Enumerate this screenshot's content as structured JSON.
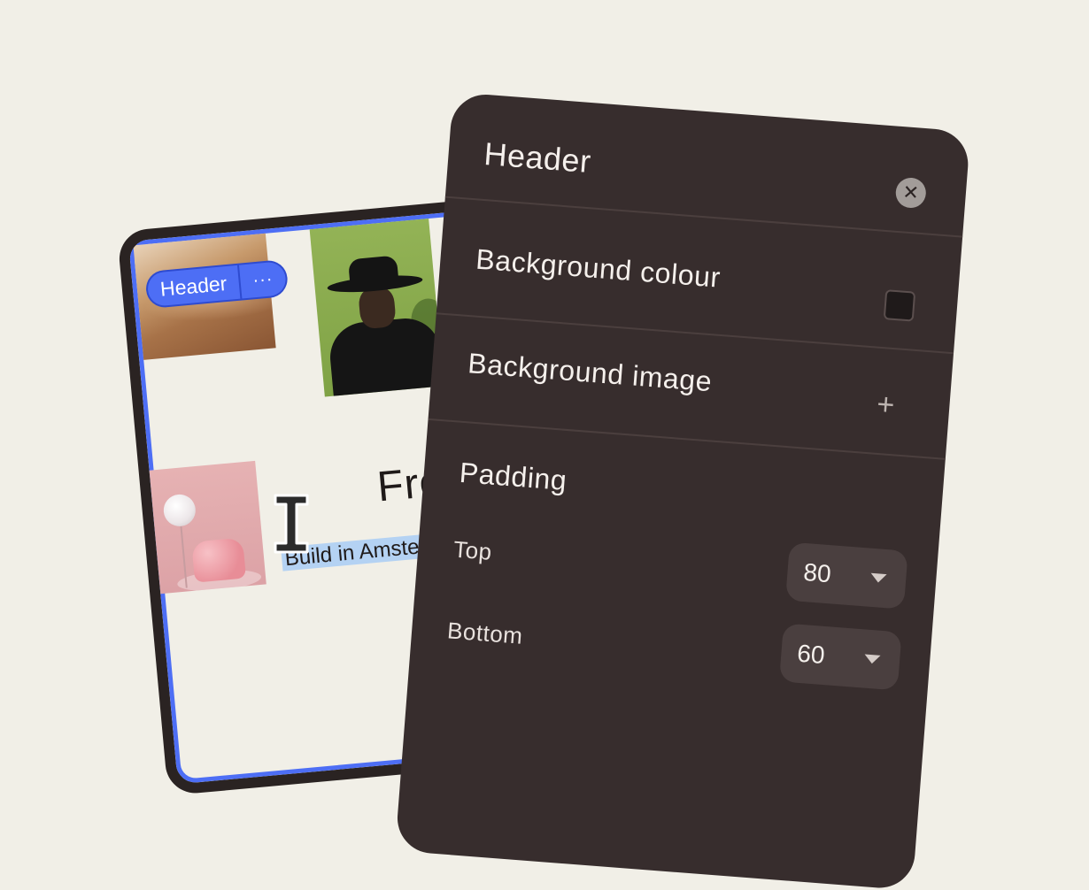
{
  "canvas": {
    "chip": {
      "label": "Header",
      "more": "···"
    },
    "hero": {
      "title": "From",
      "subtitle": "Build in Amsterd who are ge"
    },
    "images": [
      "desert-photo",
      "portrait-photo",
      "pink-room-photo"
    ]
  },
  "panel": {
    "title": "Header",
    "close_icon": "close-icon",
    "background_colour": {
      "label": "Background colour",
      "swatch_color": "#1f1a1a"
    },
    "background_image": {
      "label": "Background image",
      "add_icon": "plus-icon"
    },
    "padding": {
      "label": "Padding",
      "top": {
        "label": "Top",
        "value": "80"
      },
      "bottom": {
        "label": "Bottom",
        "value": "60"
      }
    }
  },
  "colors": {
    "accent": "#4d6ef5",
    "panel_bg": "#372d2d",
    "page_bg": "#f1efe7",
    "selection": "#b4d2f3"
  }
}
